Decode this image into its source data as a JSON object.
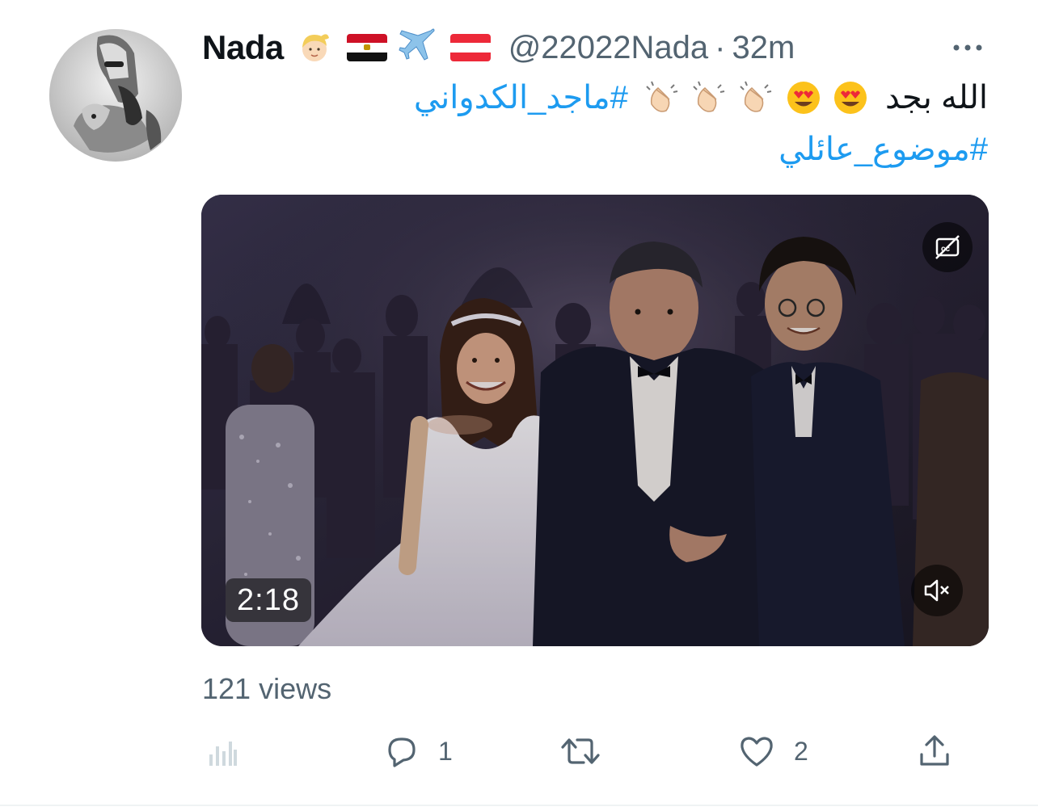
{
  "tweet": {
    "display_name": "Nada",
    "name_emojis": [
      "blonde-person-emoji",
      "egypt-flag-emoji",
      "airplane-emoji",
      "austria-flag-emoji"
    ],
    "handle": "@22022Nada",
    "separator": "·",
    "timestamp": "32m",
    "text_line1": {
      "plain": "الله بجد",
      "emojis": [
        "heart-eyes-emoji",
        "heart-eyes-emoji",
        "clapping-hands-emoji",
        "clapping-hands-emoji",
        "clapping-hands-emoji"
      ],
      "hashtag": "#ماجد_الكدواني"
    },
    "text_line2": {
      "hashtag": "#موضوع_عائلي"
    }
  },
  "media": {
    "type": "video",
    "duration": "2:18",
    "captions_icon": "captions-off-icon",
    "mute_icon": "muted-speaker-icon"
  },
  "stats": {
    "views": "121 views"
  },
  "actions": {
    "analytics_icon": "analytics-icon",
    "reply_icon": "reply-icon",
    "reply_count": "1",
    "retweet_icon": "retweet-icon",
    "retweet_count": "",
    "like_icon": "heart-icon",
    "like_count": "2",
    "share_icon": "share-icon"
  },
  "colors": {
    "accent": "#1d9bf0",
    "secondary_text": "#536471",
    "primary_text": "#0f1419"
  }
}
